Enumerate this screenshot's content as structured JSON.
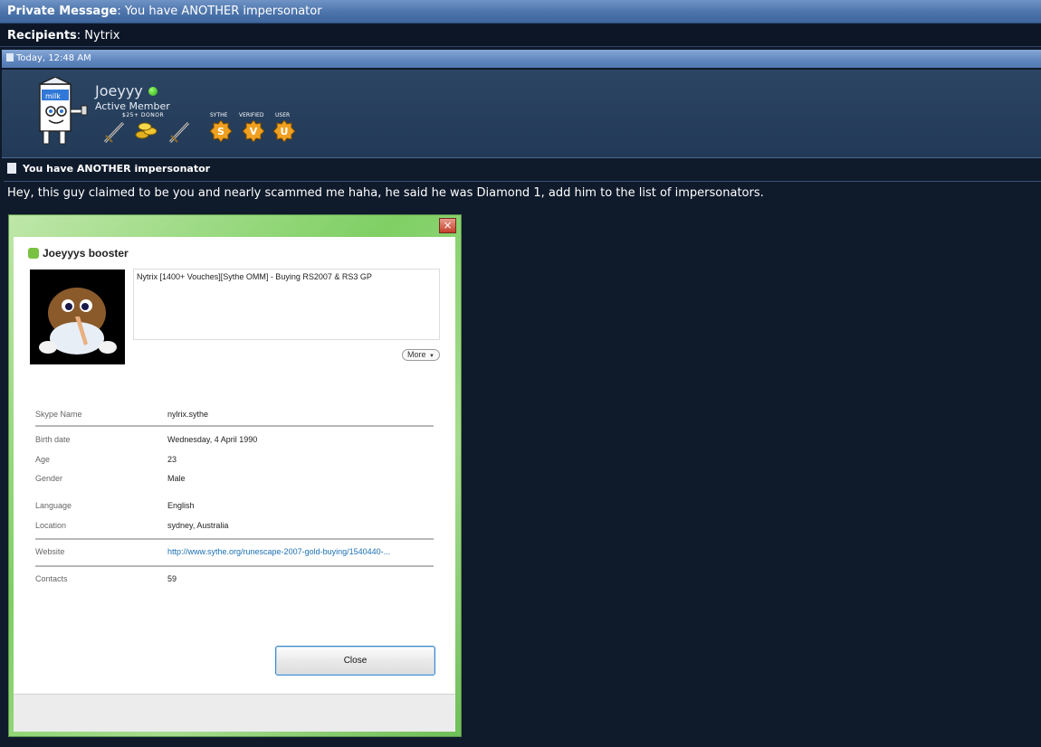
{
  "header": {
    "pm_label": "Private Message",
    "pm_subject": "You have ANOTHER impersonator",
    "recipients_label": "Recipients",
    "recipients_value": "Nytrix",
    "date": "Today, 12:48 AM"
  },
  "user": {
    "name": "Joeyyy",
    "title": "Active Member",
    "donor_label": "$25+ DONOR",
    "badge_labels": [
      "SYTHE",
      "VERIFIED",
      "USER"
    ],
    "badge_letters": [
      "S",
      "V",
      "U"
    ]
  },
  "message": {
    "title": "You have ANOTHER impersonator",
    "body": "Hey, this guy claimed to be you and nearly scammed me haha, he said he was Diamond 1, add him to the list of impersonators."
  },
  "skype": {
    "close_x": "×",
    "profile_title": "Joeyyys booster",
    "mood": "Nytrix [1400+ Vouches][Sythe OMM] - Buying RS2007 & RS3 GP",
    "more_label": "More",
    "fields": [
      {
        "label": "Skype Name",
        "value": "nylrix.sythe"
      },
      {
        "label": "Birth date",
        "value": "Wednesday, 4 April 1990"
      },
      {
        "label": "Age",
        "value": "23"
      },
      {
        "label": "Gender",
        "value": "Male"
      },
      {
        "label": "Language",
        "value": "English"
      },
      {
        "label": "Location",
        "value": "sydney, Australia"
      },
      {
        "label": "Website",
        "value": "http://www.sythe.org/runescape-2007-gold-buying/1540440-..."
      },
      {
        "label": "Contacts",
        "value": "59"
      }
    ],
    "close_button": "Close"
  },
  "colors": {
    "page_bg": "#0f1a2b",
    "header_blue": "#4c74ab",
    "online_green": "#21a516",
    "link_blue": "#1a6fb5",
    "medal_orange": "#f0a020"
  }
}
